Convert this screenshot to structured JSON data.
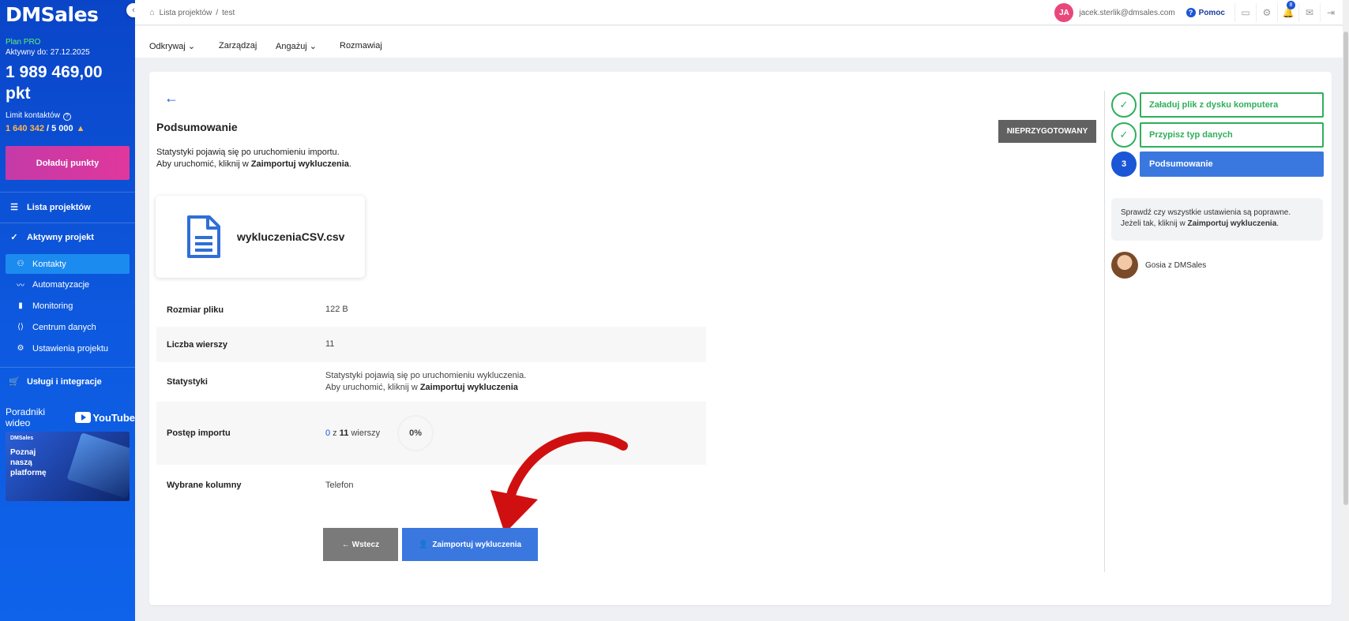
{
  "sidebar": {
    "logo": "DMSales",
    "collapse_icon": "‹",
    "plan": "Plan PRO",
    "active_until": "Aktywny do: 27.12.2025",
    "points": "1 989 469,00 pkt",
    "limit_label": "Limit kontaktów",
    "limit_current": "1 640 342",
    "limit_total": " / 5 000",
    "topup_label": "Doładuj punkty",
    "nav_projects": "Lista projektów",
    "nav_active_project": "Aktywny projekt",
    "sub_items": [
      "Kontakty",
      "Automatyzacje",
      "Monitoring",
      "Centrum danych",
      "Ustawienia projektu"
    ],
    "nav_services": "Usługi i integracje",
    "video_label": "Poradniki wideo",
    "youtube": "YouTube",
    "promo_brand": "DMSales",
    "promo_text_1": "Poznaj",
    "promo_text_2": "naszą",
    "promo_text_3": "platformę"
  },
  "topbar": {
    "breadcrumb_root": "Lista projektów",
    "breadcrumb_sep": "/",
    "breadcrumb_current": "test",
    "avatar_initials": "JA",
    "email": "jacek.sterlik@dmsales.com",
    "help": "Pomoc",
    "notification_count": "8"
  },
  "menu": [
    "Odkrywaj ⌄",
    "Zarządzaj",
    "Angażuj ⌄",
    "Rozmawiaj"
  ],
  "main": {
    "title": "Podsumowanie",
    "status": "NIEPRZYGOTOWANY",
    "intro_line1": "Statystyki pojawią się po uruchomieniu importu.",
    "intro_line2_prefix": "Aby uruchomić, kliknij w ",
    "intro_line2_bold": "Zaimportuj wykluczenia",
    "intro_line2_suffix": ".",
    "file_name": "wykluczeniaCSV.csv",
    "rows": {
      "size_label": "Rozmiar pliku",
      "size_value": "122 B",
      "rows_label": "Liczba wierszy",
      "rows_value": "11",
      "stats_label": "Statystyki",
      "stats_line1": "Statystyki pojawią się po uruchomieniu wykluczenia.",
      "stats_line2_prefix": "Aby uruchomić, kliknij w ",
      "stats_line2_bold": "Zaimportuj wykluczenia",
      "progress_label": "Postęp importu",
      "progress_done": "0",
      "progress_mid": " z ",
      "progress_total": "11",
      "progress_suffix": " wierszy",
      "progress_pct": "0%",
      "columns_label": "Wybrane kolumny",
      "columns_value": "Telefon"
    },
    "back_button": "← Wstecz",
    "import_button": "Zaimportuj wykluczenia"
  },
  "steps": [
    {
      "label": "Załaduj plik z dysku komputera",
      "marker": "✓"
    },
    {
      "label": "Przypisz typ danych",
      "marker": "✓"
    },
    {
      "label": "Podsumowanie",
      "marker": "3"
    }
  ],
  "assistant": {
    "tip_line1": "Sprawdź czy wszystkie ustawienia są poprawne.",
    "tip_line2_prefix": "Jeżeli tak, kliknij w ",
    "tip_line2_bold": "Zaimportuj wykluczenia",
    "tip_line2_suffix": ".",
    "agent_name": "Gosia z DMSales"
  },
  "colors": {
    "sidebar": "#0a45c8",
    "accent": "#1a56d6",
    "success": "#2eaf5b",
    "arrow": "#d01010"
  }
}
